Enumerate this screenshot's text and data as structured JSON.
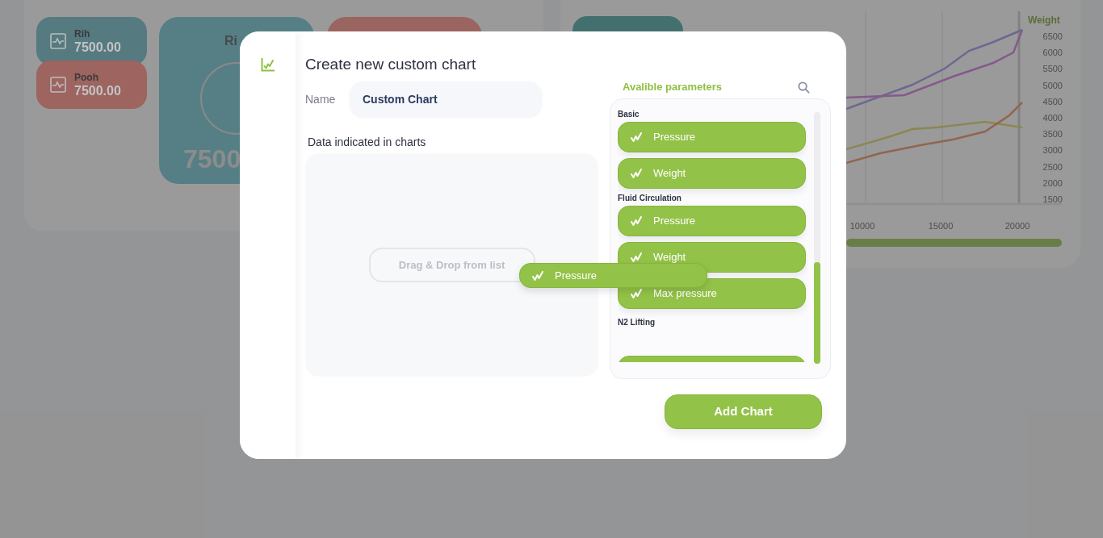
{
  "background": {
    "summary_cards": [
      {
        "label": "Rih",
        "value": "7500.00",
        "color": "#557a80"
      },
      {
        "label": "Pooh",
        "value": "7500.00",
        "color": "#9d6460"
      }
    ],
    "gauge_card": {
      "label": "Ri",
      "value": "7500"
    },
    "chart": {
      "y_axis_title": "Weight",
      "yticks": [
        "6500",
        "6000",
        "5500",
        "5000",
        "4500",
        "4000",
        "3500",
        "3000",
        "2500",
        "2000",
        "1500"
      ],
      "xticks": [
        "10000",
        "15000",
        "20000"
      ]
    }
  },
  "dialog": {
    "title": "Create new custom chart",
    "name_label": "Name",
    "name_value": "Custom Chart",
    "data_label": "Data indicated in charts",
    "drop_hint": "Drag & Drop from list",
    "parameters_title": "Avalible parameters",
    "groups": [
      {
        "name": "Basic",
        "items": [
          {
            "kind": "parameter",
            "label": "Pressure"
          },
          {
            "kind": "parameter",
            "label": "Weight"
          }
        ]
      },
      {
        "name": "Fluid Circulation",
        "items": [
          {
            "kind": "parameter",
            "label": "Pressure"
          },
          {
            "kind": "parameter",
            "label": "Weight"
          },
          {
            "kind": "parameter",
            "label": "Max pressure"
          }
        ]
      },
      {
        "name": "N2 Lifting",
        "items": [
          {
            "kind": "clipped"
          }
        ]
      }
    ],
    "dragged_item": {
      "label": "Pressure"
    },
    "add_button": "Add Chart"
  }
}
